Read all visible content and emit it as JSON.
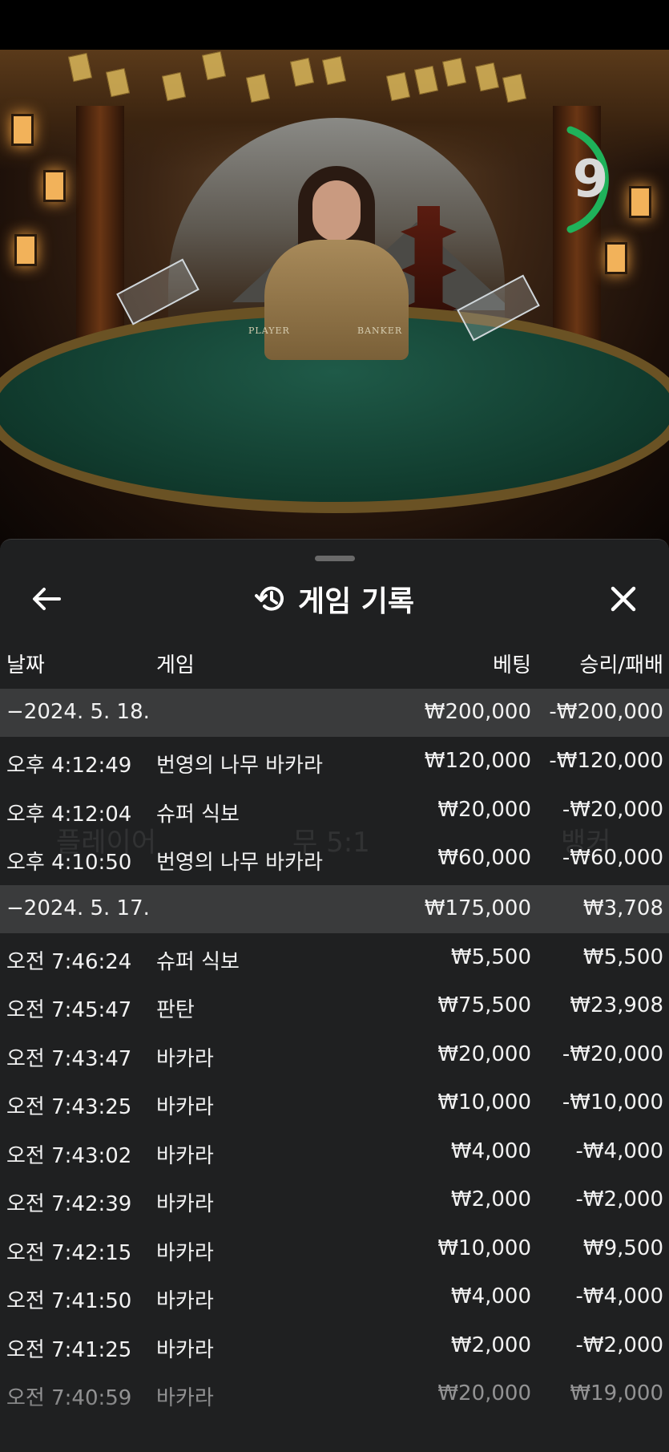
{
  "video": {
    "felt_player": "PLAYER",
    "felt_banker": "BANKER",
    "countdown": "9",
    "countdown_color": "#1fb25a"
  },
  "sheet": {
    "title": "게임 기록",
    "title_icon": "history-icon",
    "back_icon": "arrow-left-icon",
    "close_icon": "close-icon",
    "columns": {
      "date": "날짜",
      "game": "게임",
      "bet": "베팅",
      "win_loss": "승리/패배"
    },
    "groups": [
      {
        "date": "−2024. 5. 18.",
        "total_bet": "₩200,000",
        "total_win": "-₩200,000",
        "rows": [
          {
            "time": "오후 4:12:49",
            "game": "번영의 나무 바카라",
            "bet": "₩120,000",
            "win": "-₩120,000"
          },
          {
            "time": "오후 4:12:04",
            "game": "슈퍼 식보",
            "bet": "₩20,000",
            "win": "-₩20,000"
          },
          {
            "time": "오후 4:10:50",
            "game": "번영의 나무 바카라",
            "bet": "₩60,000",
            "win": "-₩60,000"
          }
        ]
      },
      {
        "date": "−2024. 5. 17.",
        "total_bet": "₩175,000",
        "total_win": "₩3,708",
        "rows": [
          {
            "time": "오전 7:46:24",
            "game": "슈퍼 식보",
            "bet": "₩5,500",
            "win": "₩5,500"
          },
          {
            "time": "오전 7:45:47",
            "game": "판탄",
            "bet": "₩75,500",
            "win": "₩23,908"
          },
          {
            "time": "오전 7:43:47",
            "game": "바카라",
            "bet": "₩20,000",
            "win": "-₩20,000"
          },
          {
            "time": "오전 7:43:25",
            "game": "바카라",
            "bet": "₩10,000",
            "win": "-₩10,000"
          },
          {
            "time": "오전 7:43:02",
            "game": "바카라",
            "bet": "₩4,000",
            "win": "-₩4,000"
          },
          {
            "time": "오전 7:42:39",
            "game": "바카라",
            "bet": "₩2,000",
            "win": "-₩2,000"
          },
          {
            "time": "오전 7:42:15",
            "game": "바카라",
            "bet": "₩10,000",
            "win": "₩9,500"
          },
          {
            "time": "오전 7:41:50",
            "game": "바카라",
            "bet": "₩4,000",
            "win": "-₩4,000"
          },
          {
            "time": "오전 7:41:25",
            "game": "바카라",
            "bet": "₩2,000",
            "win": "-₩2,000"
          },
          {
            "time": "오전 7:40:59",
            "game": "바카라",
            "bet": "₩20,000",
            "win": "₩19,000"
          }
        ]
      }
    ]
  },
  "colors": {
    "sheet_bg": "#1f2021",
    "date_row_bg": "#3a3b3c",
    "text": "#ffffff"
  }
}
